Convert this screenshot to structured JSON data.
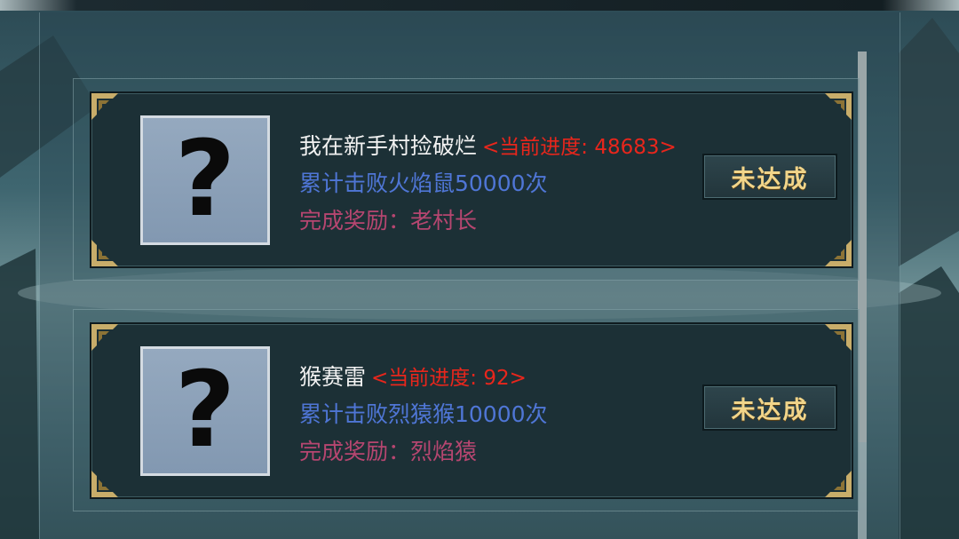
{
  "achievements": [
    {
      "title": "我在新手村捡破烂",
      "progress": "<当前进度: 48683>",
      "requirement": "累计击败火焰鼠50000次",
      "reward": "完成奖励：老村长",
      "icon": "question-mark-icon",
      "button_label": "未达成"
    },
    {
      "title": "猴赛雷",
      "progress": "<当前进度: 92>",
      "requirement": "累计击败烈猿猴10000次",
      "reward": "完成奖励：烈焰猿",
      "icon": "question-mark-icon",
      "button_label": "未达成"
    }
  ],
  "colors": {
    "title": "#f2f2f2",
    "progress": "#e8261c",
    "requirement": "#4f76d6",
    "reward": "#b64670",
    "button_text": "#f1d58a"
  }
}
